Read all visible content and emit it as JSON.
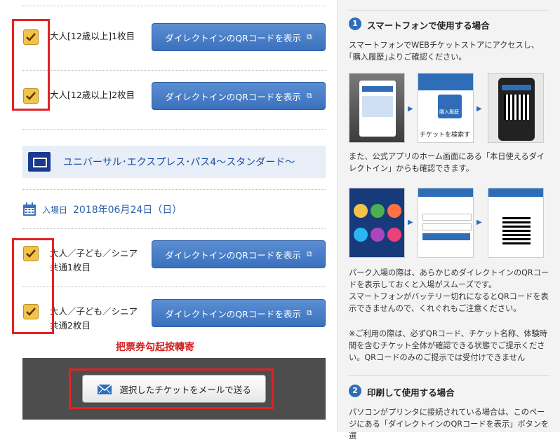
{
  "left": {
    "section_title": "ユニバーサル･エクスプレス･パス4〜スタンダード〜",
    "date_label": "入場日",
    "date_value": "2018年06月24日（日）",
    "tickets_group1": [
      {
        "label": "大人[12歳以上]1枚目",
        "button": "ダイレクトインのQRコードを表示"
      },
      {
        "label": "大人[12歳以上]2枚目",
        "button": "ダイレクトインのQRコードを表示"
      }
    ],
    "tickets_group2": [
      {
        "label": "大人／子ども／シニア共通1枚目",
        "button": "ダイレクトインのQRコードを表示"
      },
      {
        "label": "大人／子ども／シニア共通2枚目",
        "button": "ダイレクトインのQRコードを表示"
      }
    ],
    "annotation": "把票券勾起按轉寄",
    "mail_button": "選択したチケットをメールで送る"
  },
  "right": {
    "step1_number": "1",
    "step1_title": "スマートフォンで使用する場合",
    "step1_text": "スマートフォンでWEBチケットストアにアクセスし、｢購入履歴｣よりご確認ください。",
    "step1_text2": "また、公式アプリのホーム画面にある「本日使えるダイレクトイン」からも確認できます。",
    "step1_text3": "パーク入場の際は、あらかじめダイレクトインのQRコードを表示しておくと入場がスムーズです。",
    "step1_text4": "スマートフォンがバッテリー切れになるとQRコードを表示できませんので、くれぐれもご注意ください。",
    "note": "※ご利用の際は、必ずQRコード、チケット名称、体験時間を含むチケット全体が確認できる状態でご提示ください。QRコードのみのご提示では受付けできません",
    "step2_number": "2",
    "step2_title": "印刷して使用する場合",
    "step2_text": "パソコンがプリンタに接続されている場合は、このページにある「ダイレクトインのQRコードを表示」ボタンを選",
    "shot_labels": [
      "チケットを検索す",
      "購入履歴"
    ]
  },
  "colors": {
    "accent": "#3b70bd",
    "annotation_red": "#e32222",
    "checkbox": "#f2c24a"
  }
}
